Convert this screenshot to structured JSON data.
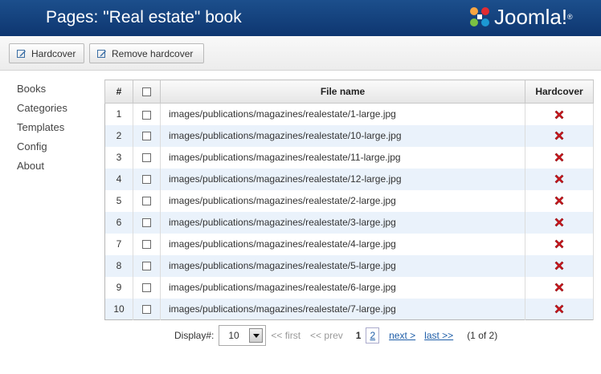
{
  "header": {
    "title": "Pages: \"Real estate\" book",
    "logo_text": "Joomla!",
    "logo_reg": "®"
  },
  "toolbar": {
    "hardcover_label": "Hardcover",
    "remove_hardcover_label": "Remove hardcover"
  },
  "sidebar": {
    "items": [
      {
        "label": "Books"
      },
      {
        "label": "Categories"
      },
      {
        "label": "Templates"
      },
      {
        "label": "Config"
      },
      {
        "label": "About"
      }
    ]
  },
  "table": {
    "headers": {
      "num": "#",
      "file": "File name",
      "hardcover": "Hardcover"
    },
    "rows": [
      {
        "num": "1",
        "file": "images/publications/magazines/realestate/1-large.jpg"
      },
      {
        "num": "2",
        "file": "images/publications/magazines/realestate/10-large.jpg"
      },
      {
        "num": "3",
        "file": "images/publications/magazines/realestate/11-large.jpg"
      },
      {
        "num": "4",
        "file": "images/publications/magazines/realestate/12-large.jpg"
      },
      {
        "num": "5",
        "file": "images/publications/magazines/realestate/2-large.jpg"
      },
      {
        "num": "6",
        "file": "images/publications/magazines/realestate/3-large.jpg"
      },
      {
        "num": "7",
        "file": "images/publications/magazines/realestate/4-large.jpg"
      },
      {
        "num": "8",
        "file": "images/publications/magazines/realestate/5-large.jpg"
      },
      {
        "num": "9",
        "file": "images/publications/magazines/realestate/6-large.jpg"
      },
      {
        "num": "10",
        "file": "images/publications/magazines/realestate/7-large.jpg"
      }
    ]
  },
  "pager": {
    "display_label": "Display#:",
    "display_value": "10",
    "first": "<< first",
    "prev": "<< prev",
    "current": "1",
    "page2": "2",
    "next": "next >",
    "last": "last >>",
    "count": "(1 of 2)"
  },
  "colors": {
    "header_bg": "#1c4f8c",
    "row_alt": "#eaf2fb",
    "delete_red": "#d0181f",
    "link": "#1f5ea8"
  }
}
